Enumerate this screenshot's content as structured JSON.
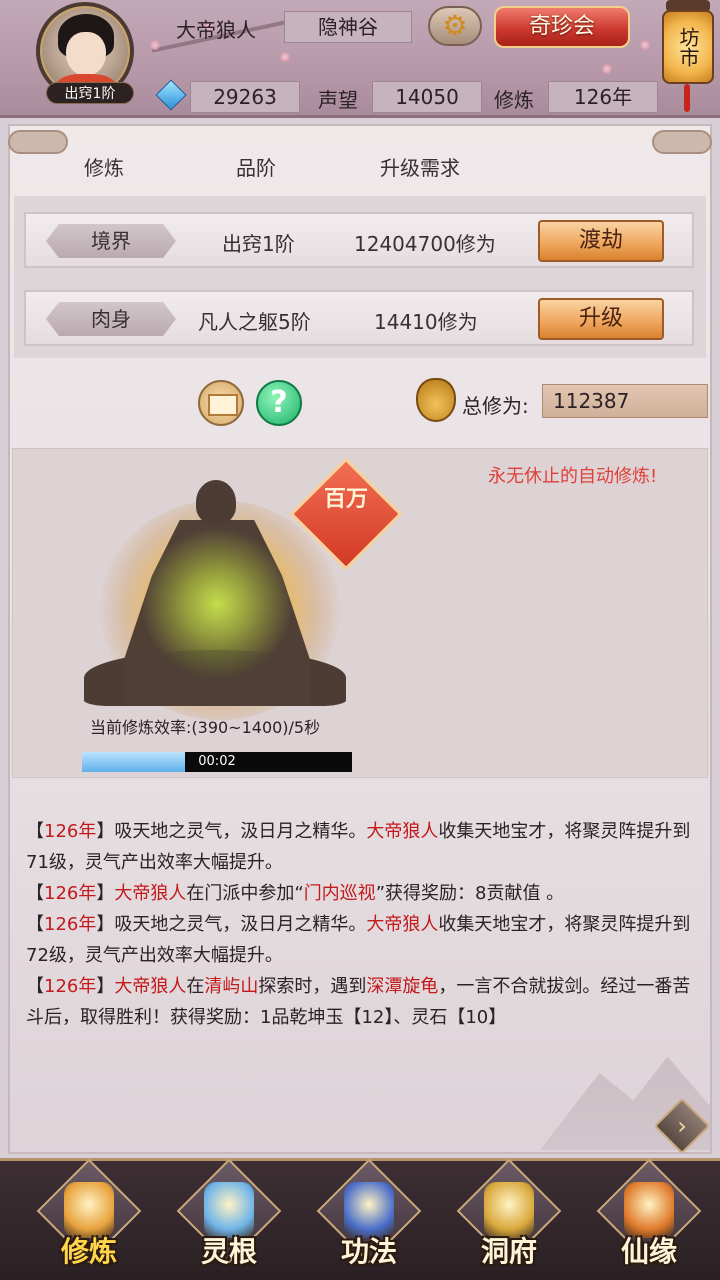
{
  "player": {
    "name": "大帝狼人",
    "rank_tag": "出窍1阶",
    "sect": "隐神谷"
  },
  "header": {
    "qizhen_label": "奇珍会",
    "fangshi_label": "坊市",
    "spirit_stones": "29263",
    "prestige_label": "声望",
    "prestige_value": "14050",
    "cultivation_label": "修炼",
    "cultivation_years": "126年"
  },
  "columns": {
    "col1": "修炼",
    "col2": "品阶",
    "col3": "升级需求"
  },
  "rows": [
    {
      "tag": "境界",
      "grade": "出窍1阶",
      "requirement": "12404700修为",
      "action": "渡劫"
    },
    {
      "tag": "肉身",
      "grade": "凡人之躯5阶",
      "requirement": "14410修为",
      "action": "升级"
    }
  ],
  "totals": {
    "label": "总修为:",
    "value": "112387"
  },
  "scene": {
    "auto_text": "永无休止的自动修炼!",
    "badge_text": "百万",
    "rate_text": "当前修炼效率:(390~1400)/5秒",
    "progress_time": "00:02",
    "progress_fraction": 0.38
  },
  "log": [
    [
      {
        "t": "【",
        "c": "n"
      },
      {
        "t": "126年",
        "c": "r"
      },
      {
        "t": "】吸天地之灵气，汲日月之精华。",
        "c": "n"
      },
      {
        "t": "大帝狼人",
        "c": "r"
      },
      {
        "t": "收集天地宝才，将聚灵阵提升到71级，灵气产出效率大幅提升。",
        "c": "n"
      }
    ],
    [
      {
        "t": "【",
        "c": "n"
      },
      {
        "t": "126年",
        "c": "r"
      },
      {
        "t": "】",
        "c": "n"
      },
      {
        "t": "大帝狼人",
        "c": "r"
      },
      {
        "t": "在门派中参加“",
        "c": "n"
      },
      {
        "t": "门内巡视",
        "c": "r"
      },
      {
        "t": "”获得奖励：8贡献值 。",
        "c": "n"
      }
    ],
    [
      {
        "t": "【",
        "c": "n"
      },
      {
        "t": "126年",
        "c": "r"
      },
      {
        "t": "】吸天地之灵气，汲日月之精华。",
        "c": "n"
      },
      {
        "t": "大帝狼人",
        "c": "r"
      },
      {
        "t": "收集天地宝才，将聚灵阵提升到72级，灵气产出效率大幅提升。",
        "c": "n"
      }
    ],
    [
      {
        "t": "【",
        "c": "n"
      },
      {
        "t": "126年",
        "c": "r"
      },
      {
        "t": "】",
        "c": "n"
      },
      {
        "t": "大帝狼人",
        "c": "r"
      },
      {
        "t": "在",
        "c": "n"
      },
      {
        "t": "清屿山",
        "c": "r"
      },
      {
        "t": "探索时，遇到",
        "c": "n"
      },
      {
        "t": "深潭旋龟",
        "c": "r"
      },
      {
        "t": "，一言不合就拔剑。经过一番苦斗后，取得胜利！获得奖励：1品乾坤玉【12】、灵石【10】",
        "c": "n"
      }
    ]
  ],
  "nav": [
    {
      "label": "修炼",
      "icon": "cultivate-icon",
      "active": true,
      "color": "#e8a23c"
    },
    {
      "label": "灵根",
      "icon": "spirit-root-icon",
      "active": false,
      "color": "#6fb4e8"
    },
    {
      "label": "功法",
      "icon": "technique-book-icon",
      "active": false,
      "color": "#4b6fc9"
    },
    {
      "label": "洞府",
      "icon": "cave-dwelling-icon",
      "active": false,
      "color": "#d9a83c"
    },
    {
      "label": "仙缘",
      "icon": "gourd-icon",
      "active": false,
      "color": "#e07b2c"
    }
  ]
}
